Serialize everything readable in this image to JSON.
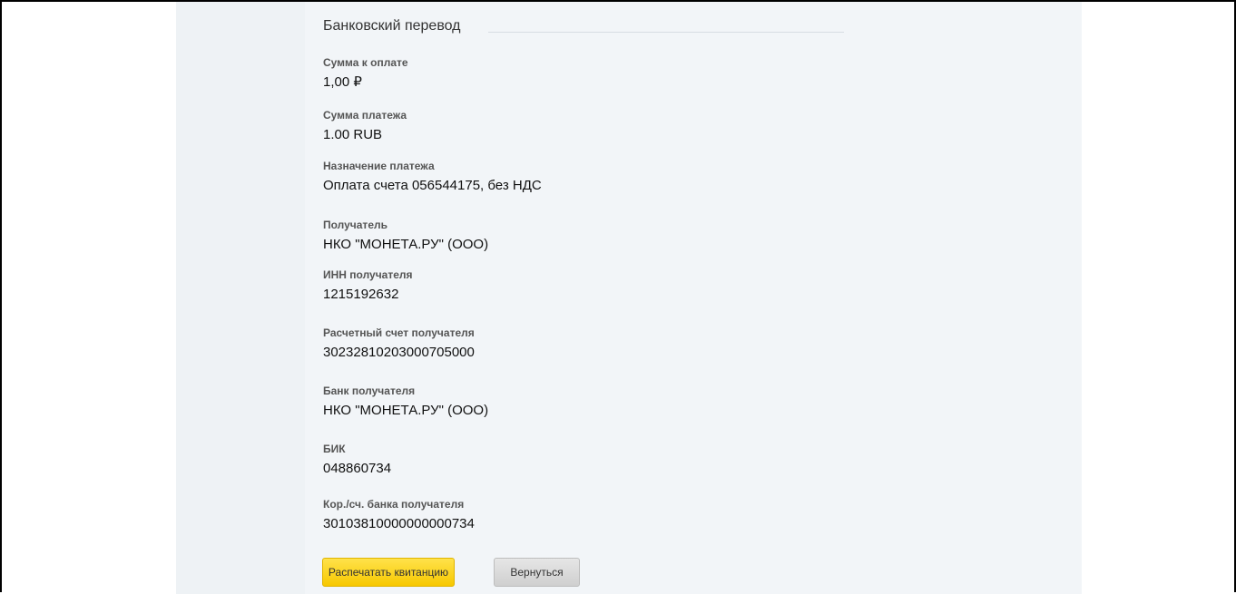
{
  "section": {
    "title": "Банковский перевод"
  },
  "fields": [
    {
      "label": "Сумма к оплате",
      "value": "1,00 ₽"
    },
    {
      "label": "Сумма платежа",
      "value": "1.00 RUB"
    },
    {
      "label": "Назначение платежа",
      "value": "Оплата счета 056544175, без НДС"
    },
    {
      "label": "Получатель",
      "value": "НКО \"МОНЕТА.РУ\" (ООО)"
    },
    {
      "label": "ИНН получателя",
      "value": "1215192632"
    },
    {
      "label": "Расчетный счет получателя",
      "value": "30232810203000705000"
    },
    {
      "label": "Банк получателя",
      "value": "НКО \"МОНЕТА.РУ\" (ООО)"
    },
    {
      "label": "БИК",
      "value": "048860734"
    },
    {
      "label": "Кор./сч. банка получателя",
      "value": "30103810000000000734"
    }
  ],
  "buttons": {
    "print_label": "Распечатать квитанцию",
    "back_label": "Вернуться"
  },
  "colors": {
    "primary_button": "#f7c800",
    "secondary_button": "#cfcfcf",
    "panel_background": "#f2f5f8"
  }
}
